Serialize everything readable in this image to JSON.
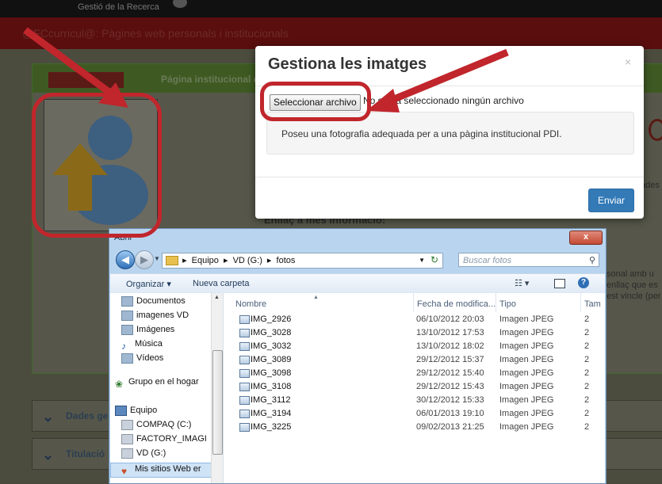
{
  "background": {
    "top_nav": "Gestió de la Recerca",
    "banner": "@FCcurricul@: Pàgines web personals i institucionals",
    "panel_title": "Página institucional d",
    "side_text_1": "ades",
    "side_text_2": "sonal amb u",
    "side_text_3": "enllaç que es",
    "side_text_4": "est vincle (per",
    "link_text": "Enllaç a més informació:",
    "accordion": [
      {
        "label": "Dades ge"
      },
      {
        "label": "Titulació"
      }
    ]
  },
  "modal": {
    "title": "Gestiona les imatges",
    "close": "×",
    "file_button": "Seleccionar archivo",
    "file_status": "No se ha seleccionado ningún archivo",
    "hint": "Poseu una fotografia adequada per a una pàgina institucional PDI.",
    "submit": "Enviar"
  },
  "dialog": {
    "title": "Abrir",
    "close": "x",
    "breadcrumb": [
      "Equipo",
      "VD (G:)",
      "fotos"
    ],
    "search_placeholder": "Buscar fotos",
    "toolbar": {
      "organize": "Organizar ▾",
      "new_folder": "Nueva carpeta"
    },
    "nav_items": [
      {
        "label": "Documentos",
        "icon": "document-folder-icon"
      },
      {
        "label": "imagenes VD",
        "icon": "folder-icon"
      },
      {
        "label": "Imágenes",
        "icon": "pictures-folder-icon"
      },
      {
        "label": "Música",
        "icon": "music-icon"
      },
      {
        "label": "Vídeos",
        "icon": "video-folder-icon"
      },
      {
        "label": "Grupo en el hogar",
        "icon": "homegroup-icon"
      },
      {
        "label": "Equipo",
        "icon": "computer-icon"
      },
      {
        "label": "COMPAQ (C:)",
        "icon": "drive-icon"
      },
      {
        "label": "FACTORY_IMAGI",
        "icon": "drive-icon"
      },
      {
        "label": "VD (G:)",
        "icon": "drive-icon",
        "selected": true
      },
      {
        "label": "Mis sitios Web er",
        "icon": "web-sites-icon"
      }
    ],
    "columns": {
      "name": "Nombre",
      "date": "Fecha de modifica...",
      "type": "Tipo",
      "size": "Tam"
    },
    "files": [
      {
        "name": "IMG_2926",
        "date": "06/10/2012 20:03",
        "type": "Imagen JPEG"
      },
      {
        "name": "IMG_3028",
        "date": "13/10/2012 17:53",
        "type": "Imagen JPEG"
      },
      {
        "name": "IMG_3032",
        "date": "13/10/2012 18:02",
        "type": "Imagen JPEG"
      },
      {
        "name": "IMG_3089",
        "date": "29/12/2012 15:37",
        "type": "Imagen JPEG"
      },
      {
        "name": "IMG_3098",
        "date": "29/12/2012 15:40",
        "type": "Imagen JPEG"
      },
      {
        "name": "IMG_3108",
        "date": "29/12/2012 15:43",
        "type": "Imagen JPEG"
      },
      {
        "name": "IMG_3112",
        "date": "30/12/2012 15:33",
        "type": "Imagen JPEG"
      },
      {
        "name": "IMG_3194",
        "date": "06/01/2013 19:10",
        "type": "Imagen JPEG"
      },
      {
        "name": "IMG_3225",
        "date": "09/02/2013 21:25",
        "type": "Imagen JPEG"
      }
    ]
  },
  "colors": {
    "annotation": "#c0262c",
    "primary_button": "#337ab7",
    "dialog_frame": "#b8d4ee"
  }
}
